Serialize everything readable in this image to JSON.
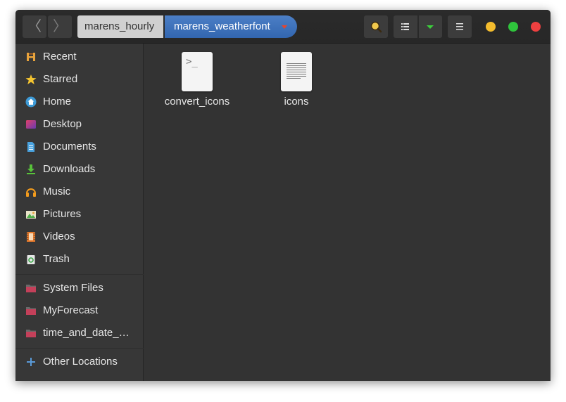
{
  "header": {
    "back_glyph": "〈",
    "forward_glyph": "〉",
    "breadcrumbs": [
      {
        "label": "marens_hourly"
      },
      {
        "label": "marens_weatherfont"
      }
    ],
    "window_controls": {
      "minimize_color": "#f4bc2d",
      "maximize_color": "#2fc43c",
      "close_color": "#ee4040"
    }
  },
  "sidebar": {
    "items": [
      {
        "label": "Recent",
        "icon": "recent-icon"
      },
      {
        "label": "Starred",
        "icon": "star-icon"
      },
      {
        "label": "Home",
        "icon": "home-icon"
      },
      {
        "label": "Desktop",
        "icon": "desktop-icon"
      },
      {
        "label": "Documents",
        "icon": "documents-icon"
      },
      {
        "label": "Downloads",
        "icon": "downloads-icon"
      },
      {
        "label": "Music",
        "icon": "music-icon"
      },
      {
        "label": "Pictures",
        "icon": "pictures-icon"
      },
      {
        "label": "Videos",
        "icon": "videos-icon"
      },
      {
        "label": "Trash",
        "icon": "trash-icon"
      }
    ],
    "bookmarks": [
      {
        "label": "System Files",
        "icon": "folder-icon"
      },
      {
        "label": "MyForecast",
        "icon": "folder-icon"
      },
      {
        "label": "time_and_date_…",
        "icon": "folder-icon"
      }
    ],
    "other": {
      "label": "Other Locations",
      "icon": "plus-icon"
    }
  },
  "files": [
    {
      "name": "convert_icons",
      "icon": "script-file-icon",
      "glyph": ">_"
    },
    {
      "name": "icons",
      "icon": "text-file-icon"
    }
  ],
  "colors": {
    "accent": "#3d72bd",
    "sidebar_bg": "#373737",
    "content_bg": "#333333"
  }
}
